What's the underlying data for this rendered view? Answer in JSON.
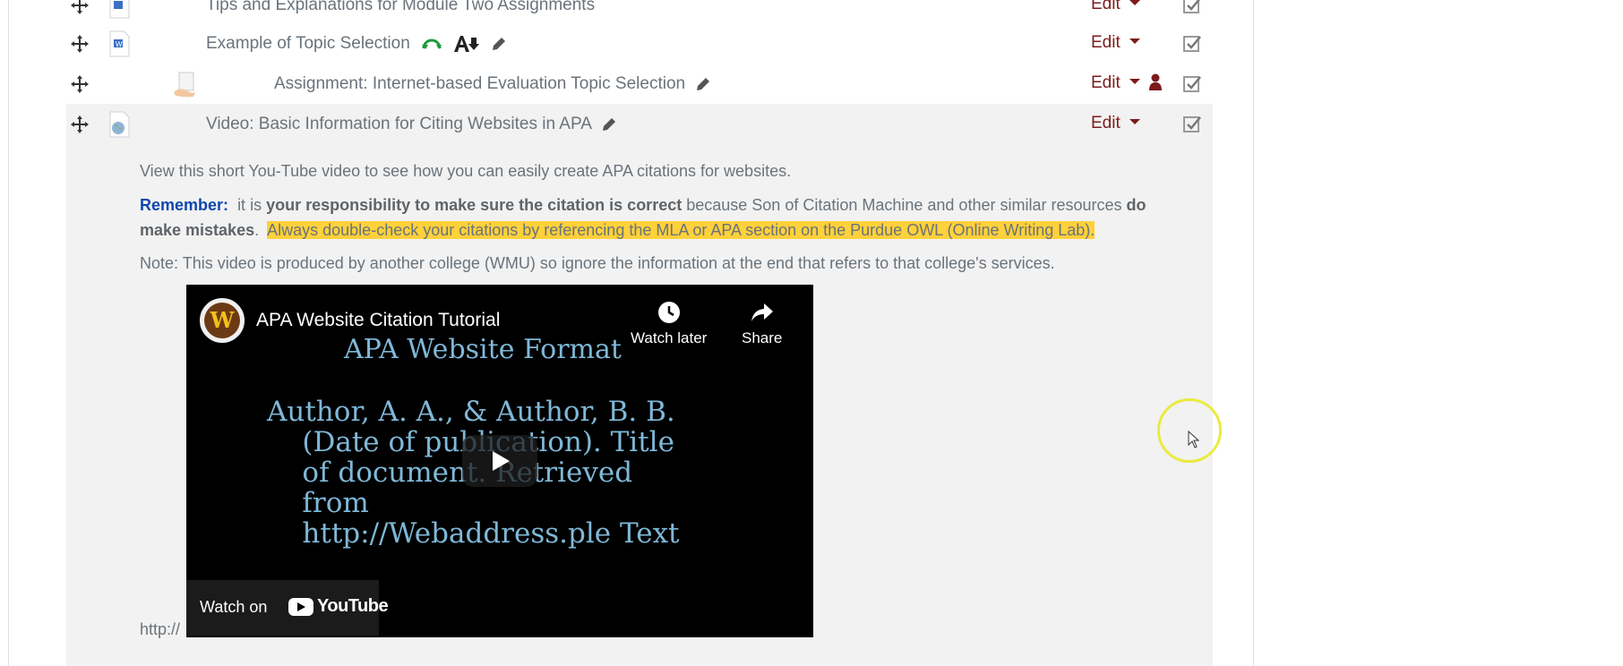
{
  "rows": [
    {
      "title": "Tips and Explanations for Module Two Assignments",
      "edit": "Edit"
    },
    {
      "title": "Example of Topic Selection",
      "edit": "Edit"
    },
    {
      "title": "Assignment: Internet-based Evaluation Topic Selection",
      "edit": "Edit"
    },
    {
      "title": "Video: Basic Information for Citing Websites in APA",
      "edit": "Edit"
    }
  ],
  "description": {
    "line1": "View this short You-Tube video to see how you can easily create APA citations for websites.",
    "remember_label": "Remember:",
    "p2_a": "it is",
    "p2_b": "your responsibility to make sure the citation is correct",
    "p2_c": "because Son of Citation Machine and other similar resources",
    "p2_d": "do",
    "p2_e": "make mistakes",
    "p2_f": ".",
    "p2_highlight": "Always double-check your citations by referencing the MLA or APA section on the Purdue OWL (Online Writing Lab).",
    "note": "Note:  This video is produced by another college (WMU) so ignore the information at the end that refers to that college's services."
  },
  "video": {
    "channel_initial": "W",
    "title": "APA Website Citation Tutorial",
    "watch_later": "Watch later",
    "share": "Share",
    "slide_heading": "APA Website Format",
    "slide_body": "Author, A. A., & Author, B. B.\n    (Date of publication). Title\n    of document. Retrieved\n    from\n    http://Webaddress.ple Text",
    "watch_on": "Watch on",
    "youtube": "YouTube"
  },
  "trailing_text": "http://",
  "colors": {
    "edit": "#7c1c1c",
    "remember": "#0f47ad",
    "highlight": "#ffd13a",
    "hl_bg": "#f2f2f2"
  }
}
